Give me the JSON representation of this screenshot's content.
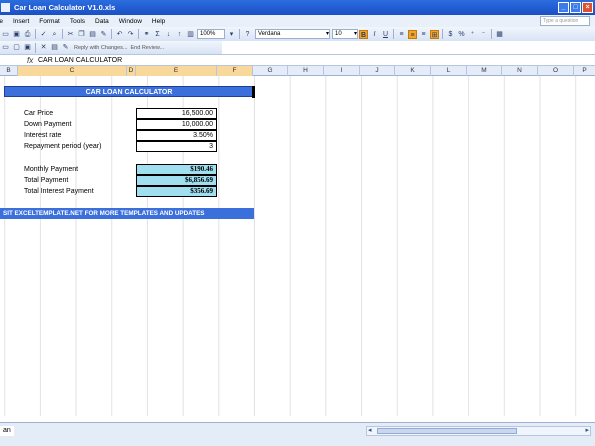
{
  "window": {
    "title": "Car Loan Calculator V1.0.xls",
    "minimize": "_",
    "maximize": "□",
    "close": "×"
  },
  "menu": {
    "items": [
      "File",
      "Insert",
      "Format",
      "Tools",
      "Data",
      "Window",
      "Help"
    ],
    "ask_placeholder": "Type a question"
  },
  "toolbar": {
    "zoom": "100%",
    "font": "Verdana",
    "font_size": "10",
    "bold": "B",
    "italic": "I",
    "underline": "U",
    "currency": "$",
    "percent": "%",
    "dropdown_arrow": "▾"
  },
  "review_bar": {
    "reply": "Reply with Changes...",
    "end_review": "End Review..."
  },
  "formula_bar": {
    "fx": "fx",
    "content": "CAR LOAN CALCULATOR"
  },
  "columns": [
    "B",
    "C",
    "D",
    "E",
    "F",
    "G",
    "H",
    "I",
    "J",
    "K",
    "L",
    "M",
    "N",
    "O",
    "P"
  ],
  "calculator": {
    "header": "CAR LOAN CALCULATOR",
    "inputs": [
      {
        "label": "Car Price",
        "value": "16,500.00"
      },
      {
        "label": "Down Payment",
        "value": "10,000.00"
      },
      {
        "label": "Interest rate",
        "value": "3.50%"
      },
      {
        "label": "Repayment period (year)",
        "value": "3"
      }
    ],
    "outputs": [
      {
        "label": "Monthly Payment",
        "value": "$190.46"
      },
      {
        "label": "Total Payment",
        "value": "$6,856.69"
      },
      {
        "label": "Total Interest Payment",
        "value": "$356.69"
      }
    ],
    "footer": "SIT EXCELTEMPLATE.NET FOR MORE TEMPLATES AND UPDATES"
  },
  "sheets": {
    "active_tab": "an"
  },
  "colors": {
    "header_blue": "#3b6fdc",
    "result_cyan": "#9fdfef",
    "titlebar_blue": "#1a50c5"
  }
}
